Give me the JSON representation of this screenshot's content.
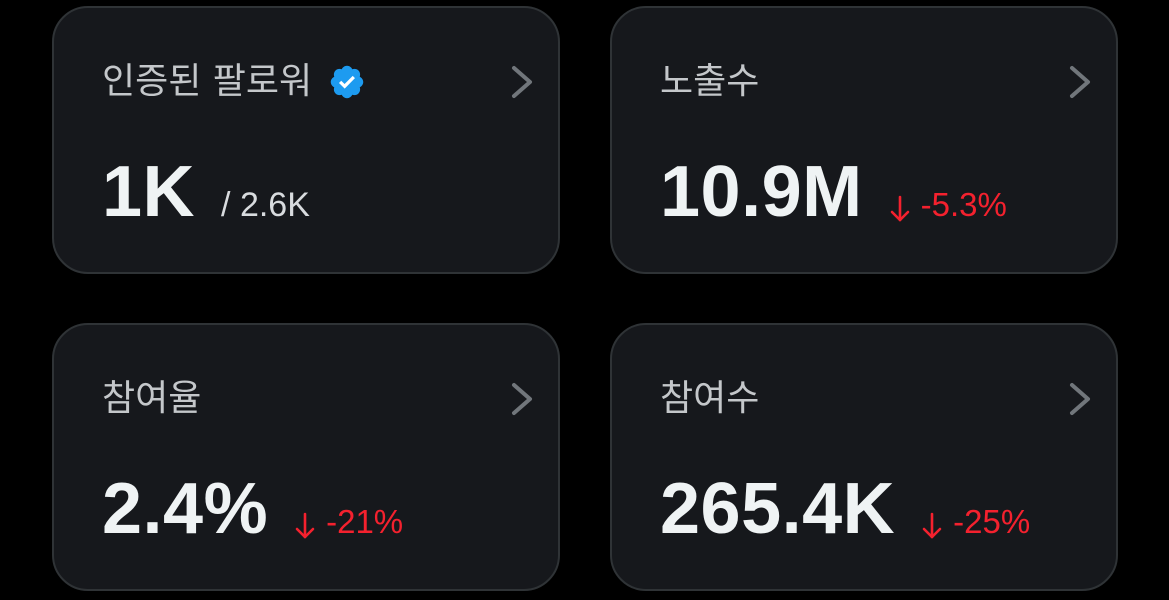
{
  "cards": [
    {
      "title": "인증된 팔로워",
      "verified_icon": "verified-badge-icon",
      "value": "1K",
      "secondary": "/ 2.6K",
      "chevron_icon": "chevron-right-icon"
    },
    {
      "title": "노출수",
      "value": "10.9M",
      "change": "-5.3%",
      "change_icon": "arrow-down-icon",
      "chevron_icon": "chevron-right-icon"
    },
    {
      "title": "참여율",
      "value": "2.4%",
      "change": "-21%",
      "change_icon": "arrow-down-icon",
      "chevron_icon": "chevron-right-icon"
    },
    {
      "title": "참여수",
      "value": "265.4K",
      "change": "-25%",
      "change_icon": "arrow-down-icon",
      "chevron_icon": "chevron-right-icon"
    }
  ],
  "colors": {
    "background": "#000000",
    "card_background": "#16181c",
    "card_border": "#2f3336",
    "title_text": "#c4c7ca",
    "value_text": "#eff3f4",
    "negative_change": "#f4212e",
    "verified_blue": "#1d9bf0",
    "chevron": "#71767b"
  }
}
